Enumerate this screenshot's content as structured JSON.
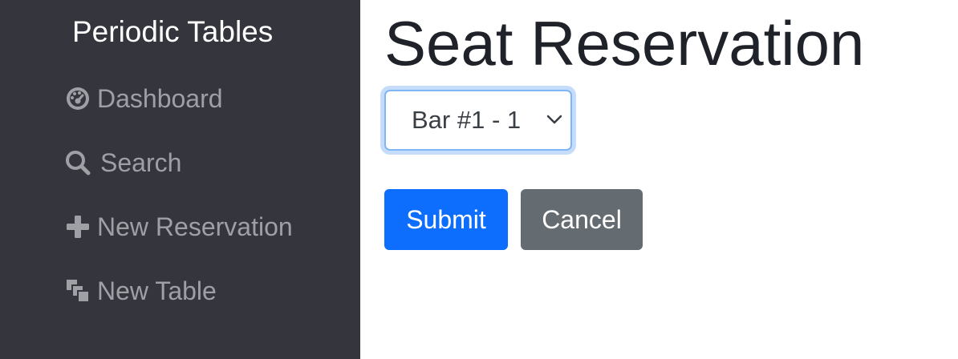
{
  "sidebar": {
    "brand": "Periodic Tables",
    "items": [
      {
        "label": "Dashboard",
        "icon": "dashboard-icon"
      },
      {
        "label": "Search",
        "icon": "search-icon"
      },
      {
        "label": "New Reservation",
        "icon": "plus-icon"
      },
      {
        "label": "New Table",
        "icon": "layers-icon"
      }
    ]
  },
  "main": {
    "title": "Seat Reservation",
    "table_select": {
      "selected": "Bar #1 - 1"
    },
    "submit_label": "Submit",
    "cancel_label": "Cancel"
  },
  "colors": {
    "sidebar_bg": "#34353d",
    "nav_text": "#9ea0a5",
    "primary": "#0d6efd",
    "secondary": "#646b71",
    "focus_ring": "#c6dcfb"
  }
}
